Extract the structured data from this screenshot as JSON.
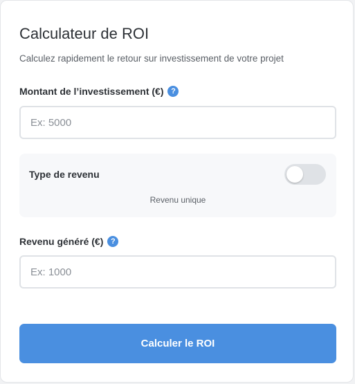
{
  "header": {
    "title": "Calculateur de ROI",
    "subtitle": "Calculez rapidement le retour sur investissement de votre projet"
  },
  "investment": {
    "label": "Montant de l’investissement (€)",
    "help_icon": "question-circle-icon",
    "help_glyph": "?",
    "value": "",
    "placeholder": "Ex: 5000"
  },
  "revenue_type": {
    "label": "Type de revenu",
    "toggle_on": false,
    "state_text": "Revenu unique"
  },
  "revenue": {
    "label": "Revenu généré (€)",
    "help_icon": "question-circle-icon",
    "help_glyph": "?",
    "value": "",
    "placeholder": "Ex: 1000"
  },
  "actions": {
    "submit_label": "Calculer le ROI"
  },
  "colors": {
    "accent": "#4a8fe0",
    "toggle_off": "#dfe2e6",
    "panel_bg": "#f7f8fa"
  }
}
